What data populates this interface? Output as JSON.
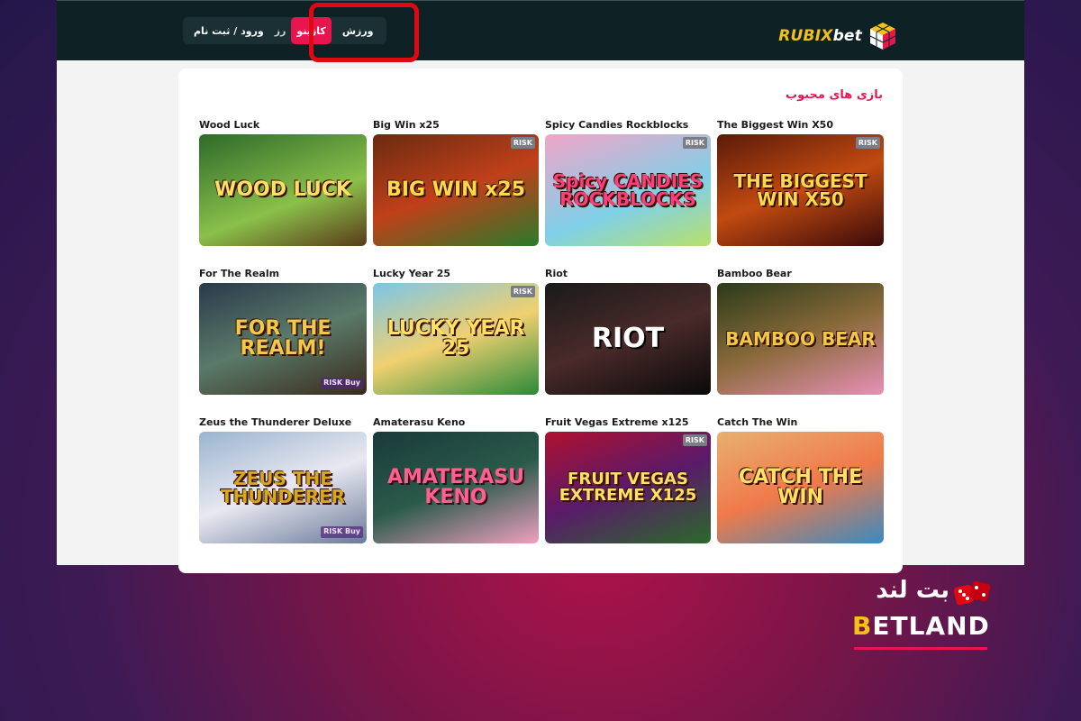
{
  "brand": {
    "part1": "RUBIX",
    "part2": "bet"
  },
  "nav": {
    "login_label": "ورود / ثبت نام",
    "casino_label": "کازینو",
    "sports_label": "ورزش",
    "partial_label": "رز"
  },
  "section": {
    "title": "بازی های محبوب"
  },
  "games": [
    {
      "title": "Wood Luck",
      "thumb_text": "WOOD LUCK",
      "risk": ""
    },
    {
      "title": "Big Win x25",
      "thumb_text": "BIG WIN x25",
      "risk": "RISK"
    },
    {
      "title": "Spicy Candies Rockblocks",
      "thumb_text": "Spicy CANDIES ROCKBLOCKS",
      "risk": "RISK"
    },
    {
      "title": "The Biggest Win X50",
      "thumb_text": "THE BIGGEST WIN X50",
      "risk": "RISK"
    },
    {
      "title": "For The Realm",
      "thumb_text": "FOR THE REALM!",
      "risk": "RISK Buy"
    },
    {
      "title": "Lucky Year 25",
      "thumb_text": "LUCKY YEAR 25",
      "risk": "RISK"
    },
    {
      "title": "Riot",
      "thumb_text": "RIOT",
      "risk": ""
    },
    {
      "title": "Bamboo Bear",
      "thumb_text": "BAMBOO BEAR",
      "risk": ""
    },
    {
      "title": "Zeus the Thunderer Deluxe",
      "thumb_text": "ZEUS THE THUNDERER",
      "risk": "RISK Buy"
    },
    {
      "title": "Amaterasu Keno",
      "thumb_text": "AMATERASU KENO",
      "risk": ""
    },
    {
      "title": "Fruit Vegas Extreme x125",
      "thumb_text": "FRUIT VEGAS EXTREME X125",
      "risk": "RISK"
    },
    {
      "title": "Catch The Win",
      "thumb_text": "CATCH THE WIN",
      "risk": ""
    }
  ],
  "watermark": {
    "fa": "بت لند",
    "en_gold": "B",
    "en_white": "ETLAND"
  },
  "colors": {
    "accent": "#e8164f",
    "topbar": "#0e2226",
    "highlight": "#e00812",
    "brand_gold": "#f2c21b"
  }
}
